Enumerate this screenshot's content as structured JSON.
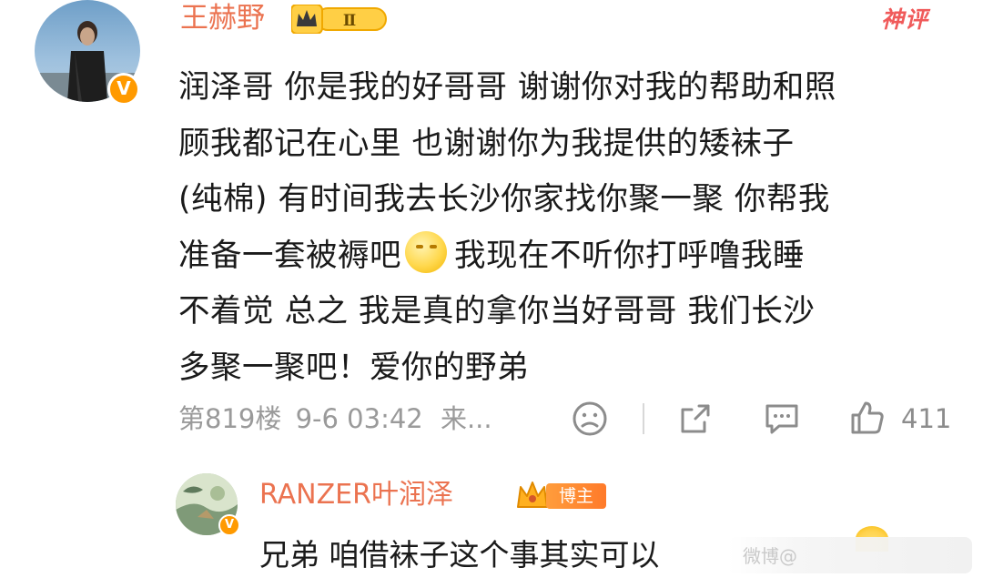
{
  "main_comment": {
    "username": "王赫野",
    "level_badge": "Ⅱ",
    "tag": "神评",
    "verified_mark": "V",
    "lines": [
      "润泽哥 你是我的好哥哥 谢谢你对我的帮助和照",
      "顾我都记在心里 也谢谢你为我提供的矮袜子",
      "(纯棉) 有时间我去长沙你家找你聚一聚 你帮我",
      "准备一套被褥吧",
      "我现在不听你打呼噜我睡",
      "不着觉 总之 我是真的拿你当好哥哥 我们长沙",
      "多聚一聚吧！爱你的野弟"
    ],
    "floor": "第819楼",
    "timestamp": "9-6 03:42",
    "source": "来...",
    "like_count": "411",
    "icons": [
      "sad-face-icon",
      "share-icon",
      "comment-icon",
      "like-icon"
    ]
  },
  "reply": {
    "username": "RANZER叶润泽",
    "badge": "博主",
    "verified_mark": "V",
    "text": "兄弟 咱借袜子这个事其实可以",
    "watermark": "微博@"
  },
  "colors": {
    "username": "#eb7350",
    "tag": "#f05a5a",
    "meta": "#9a9a9a",
    "badge": "#ff9a00"
  }
}
